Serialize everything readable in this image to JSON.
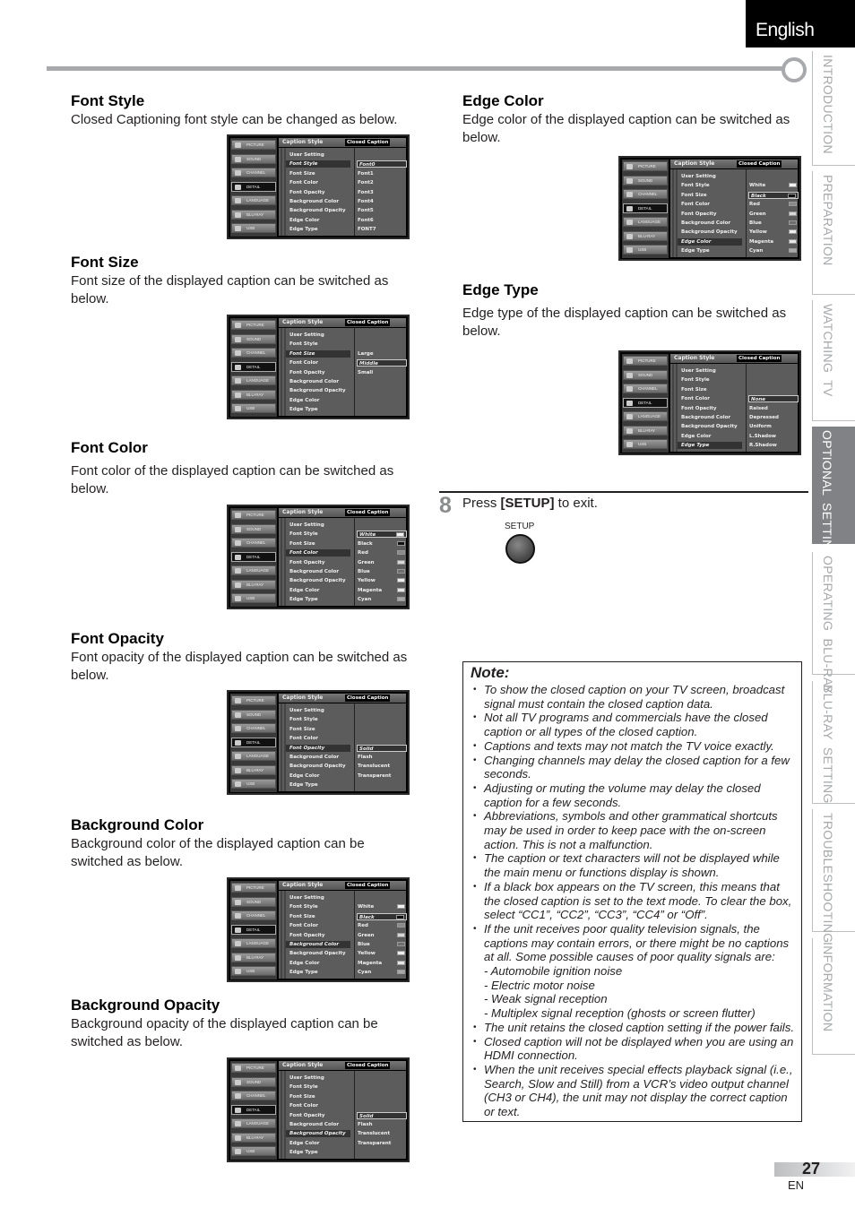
{
  "header": {
    "language": "English"
  },
  "side_tabs": [
    {
      "label": "INTRODUCTION",
      "active": false
    },
    {
      "label": "PREPARATION",
      "active": false
    },
    {
      "label": "WATCHING  TV",
      "active": false
    },
    {
      "label": "OPTIONAL  SETTING",
      "active": true
    },
    {
      "label": "OPERATING  BLU-RAY",
      "active": false
    },
    {
      "label": "BLU-RAY  SETTING",
      "active": false
    },
    {
      "label": "TROUBLESHOOTING",
      "active": false
    },
    {
      "label": "INFORMATION",
      "active": false
    }
  ],
  "osd_common": {
    "nav": [
      "PICTURE",
      "SOUND",
      "CHANNEL",
      "DETAIL",
      "LANGUAGE",
      "BLU-RAY",
      "USB"
    ],
    "nav_selected": "DETAIL",
    "header_left": "Caption Style",
    "header_right": "Closed Caption",
    "menu": [
      "User Setting",
      "Font Style",
      "Font Size",
      "Font Color",
      "Font Opacity",
      "Background Color",
      "Background Opacity",
      "Edge Color",
      "Edge Type"
    ]
  },
  "sections": {
    "font_style": {
      "title": "Font Style",
      "desc": "Closed Captioning font style can be changed as below.",
      "selected_menu": "Font Style",
      "options": [
        "Font0",
        "Font1",
        "Font2",
        "Font3",
        "Font4",
        "Font5",
        "Font6",
        "FONT7"
      ],
      "selected_option": "Font0",
      "swatches": false
    },
    "font_size": {
      "title": "Font Size",
      "desc": "Font size of the displayed caption can be switched as below.",
      "selected_menu": "Font Size",
      "options": [
        "Large",
        "Middle",
        "Small"
      ],
      "selected_option": "Middle",
      "swatches": false
    },
    "font_color": {
      "title": "Font Color",
      "desc": "Font color of the displayed caption can be switched as below.",
      "selected_menu": "Font Color",
      "options": [
        "White",
        "Black",
        "Red",
        "Green",
        "Blue",
        "Yellow",
        "Magenta",
        "Cyan"
      ],
      "selected_option": "White",
      "swatches": true
    },
    "font_opacity": {
      "title": "Font Opacity",
      "desc": "Font opacity of the displayed caption can be switched as below.",
      "selected_menu": "Font Opacity",
      "options": [
        "Solid",
        "Flash",
        "Translucent",
        "Transparent"
      ],
      "selected_option": "Solid",
      "swatches": false
    },
    "background_color": {
      "title": "Background Color",
      "desc": "Background color of the displayed caption can be switched as below.",
      "selected_menu": "Background Color",
      "options": [
        "White",
        "Black",
        "Red",
        "Green",
        "Blue",
        "Yellow",
        "Magenta",
        "Cyan"
      ],
      "selected_option": "Black",
      "swatches": true
    },
    "background_opacity": {
      "title": "Background Opacity",
      "desc": "Background opacity of the displayed caption can be switched as below.",
      "selected_menu": "Background Opacity",
      "options": [
        "Solid",
        "Flash",
        "Translucent",
        "Transparent"
      ],
      "selected_option": "Solid",
      "swatches": false
    },
    "edge_color": {
      "title": "Edge Color",
      "desc": "Edge color of the displayed caption can be switched as below.",
      "selected_menu": "Edge Color",
      "options": [
        "White",
        "Black",
        "Red",
        "Green",
        "Blue",
        "Yellow",
        "Magenta",
        "Cyan"
      ],
      "selected_option": "Black",
      "swatches": true
    },
    "edge_type": {
      "title": "Edge Type",
      "desc": "Edge type of the displayed caption can be switched as below.",
      "selected_menu": "Edge Type",
      "options": [
        "None",
        "Raised",
        "Depressed",
        "Uniform",
        "L.Shadow",
        "R.Shadow"
      ],
      "selected_option": "None",
      "swatches": false
    }
  },
  "swatch_colors": {
    "White": "#f2f2f2",
    "Black": "#111111",
    "Red": "#8a8a8a",
    "Green": "#d8d8d8",
    "Blue": "#6e6e6e",
    "Yellow": "#eeeeee",
    "Magenta": "#e6e6e6",
    "Cyan": "#a8a8a8"
  },
  "step": {
    "number": "8",
    "text_pre": "Press ",
    "text_key": "[SETUP]",
    "text_post": " to exit.",
    "button_label": "SETUP"
  },
  "note": {
    "title": "Note:",
    "items": [
      {
        "type": "bullet",
        "text": "To show the closed caption on your TV screen, broadcast signal must contain the closed caption data."
      },
      {
        "type": "bullet",
        "text": "Not all TV programs and commercials have the closed caption or all types of the closed caption."
      },
      {
        "type": "bullet",
        "text": "Captions and texts may not match the TV voice exactly."
      },
      {
        "type": "bullet",
        "text": "Changing channels may delay the closed caption for a few seconds."
      },
      {
        "type": "bullet",
        "text": "Adjusting or muting the volume may delay the closed caption for a few seconds."
      },
      {
        "type": "bullet",
        "text": "Abbreviations, symbols and other grammatical shortcuts may be used in order to keep pace with the on-screen action. This is not a malfunction."
      },
      {
        "type": "bullet",
        "text": "The caption or text characters will not be displayed while the main menu or functions display is shown."
      },
      {
        "type": "bullet",
        "text": "If a black box appears on the TV screen, this means that the closed caption is set to the text mode. To clear the box, select “CC1”, “CC2”, “CC3”, “CC4” or “Off”."
      },
      {
        "type": "bullet",
        "text": "If the unit receives poor quality television signals, the captions may contain errors, or there might be no captions at all. Some possible causes of poor quality signals are:"
      },
      {
        "type": "sub",
        "text": "- Automobile ignition noise"
      },
      {
        "type": "sub",
        "text": "- Electric motor noise"
      },
      {
        "type": "sub",
        "text": "- Weak signal reception"
      },
      {
        "type": "sub",
        "text": "- Multiplex signal reception (ghosts or screen flutter)"
      },
      {
        "type": "bullet",
        "text": "The unit retains the closed caption setting if the power fails."
      },
      {
        "type": "bullet",
        "text": "Closed caption will not be displayed when you are using an HDMI connection."
      },
      {
        "type": "bullet",
        "text": "When the unit receives special effects playback signal (i.e., Search, Slow and Still) from a VCR’s video output channel (CH3 or CH4), the unit may not display the correct caption or text."
      }
    ]
  },
  "footer": {
    "page": "27",
    "lang_code": "EN"
  }
}
